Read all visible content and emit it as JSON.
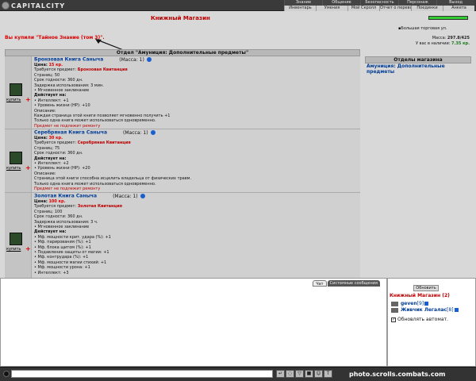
{
  "logo": {
    "text": "CAPITALCITY"
  },
  "menu": {
    "row1": [
      "Знание",
      "Общение",
      "Безопасность",
      "Персонаж",
      "Выход"
    ],
    "row2": [
      "Инвентарь",
      "Умения",
      "Мой Скролл",
      "Отчет о переводах",
      "Поединки",
      "Анкета"
    ]
  },
  "shop_title": "Книжный Магазин",
  "purchase_message": "Вы купили \"Тайное Знание (том 3)\".",
  "hp_fraction": 1.0,
  "location": "Большая торговая ул.",
  "mass_label": "Масса:",
  "mass_value": "297.8/425",
  "money_label": "У вас в наличии:",
  "money_value": "7.35 кр.",
  "dept_header": "Отдел \"Амуниция: Дополнительные предметы\"",
  "right_panel": {
    "header": "Отделы магазина",
    "link": "Амуниция: Дополнительные предметы"
  },
  "items": [
    {
      "name": "Бронзовая Книга Саныча",
      "mass": "(Масса: 1)",
      "price_label": "Цена:",
      "price": "15 кр.",
      "req_label": "Требуется предмет:",
      "req": "Бронзовая Квитанция",
      "lines": [
        "Страниц: 50",
        "Срок годности: 360 дн.",
        "Задержка использования: 3 мин.",
        "• Мгновенное заклинание"
      ],
      "acts": "Действует на:",
      "effects": [
        "• Интеллект: +1",
        "• Уровень жизни (HP): +10"
      ],
      "desc_label": "Описание:",
      "desc": [
        "Каждая страница этой книги позволяет мгновенно получить +1",
        "Только одна книга может использоваться одновременно."
      ],
      "warn": "Предмет не подлежит ремонту",
      "buy": "купить"
    },
    {
      "name": "Серебряная Книга Саныча",
      "mass": "(Масса: 1)",
      "price_label": "Цена:",
      "price": "30 кр.",
      "req_label": "Требуется предмет:",
      "req": "Серебряная Квитанция",
      "lines": [
        "Страниц: 75",
        "Срок годности: 360 дн."
      ],
      "acts": "Действует на:",
      "effects": [
        "• Интеллект: +2",
        "• Уровень жизни (HP): +20"
      ],
      "desc_label": "Описание:",
      "desc": [
        "Страница этой книги способна исцелить владельца от физических травм.",
        "Только одна книга может использоваться одновременно."
      ],
      "warn": "Предмет не подлежит ремонту",
      "buy": "купить"
    },
    {
      "name": "Золотая Книга Саныча",
      "mass": "(Масса: 1)",
      "price_label": "Цена:",
      "price": "100 кр.",
      "req_label": "Требуется предмет:",
      "req": "Золотая Квитанция",
      "lines": [
        "Страниц: 100",
        "Срок годности: 360 дн.",
        "Задержка использования: 3 ч.",
        "• Мгновенное заклинание"
      ],
      "acts": "Действует на:",
      "effects": [
        "• Мф. мощности крит. удара (%): +1",
        "• Мф. парирования (%): +1",
        "• Мф. блока щитом (%): +1",
        "• Подавление защиты от магии: +1",
        "• Мф. контрудара (%): +1",
        "• Мф. мощности магии стихий: +1",
        "• Мф. мощности урона: +1",
        "• Интеллект: +3"
      ],
      "buy": "купить"
    }
  ],
  "chat": {
    "tab_chat": "Чат",
    "tab_system": "Системные сообщения"
  },
  "online": {
    "refresh": "Обновить",
    "room": "Книжный Магазин (2)",
    "users": [
      {
        "name": "geven",
        "level": "[9]"
      },
      {
        "name": "Живчик Легалас",
        "level": "[8]"
      }
    ],
    "auto": "Обновлять автомат."
  },
  "watermark": "photo.scrolls.combats.com"
}
